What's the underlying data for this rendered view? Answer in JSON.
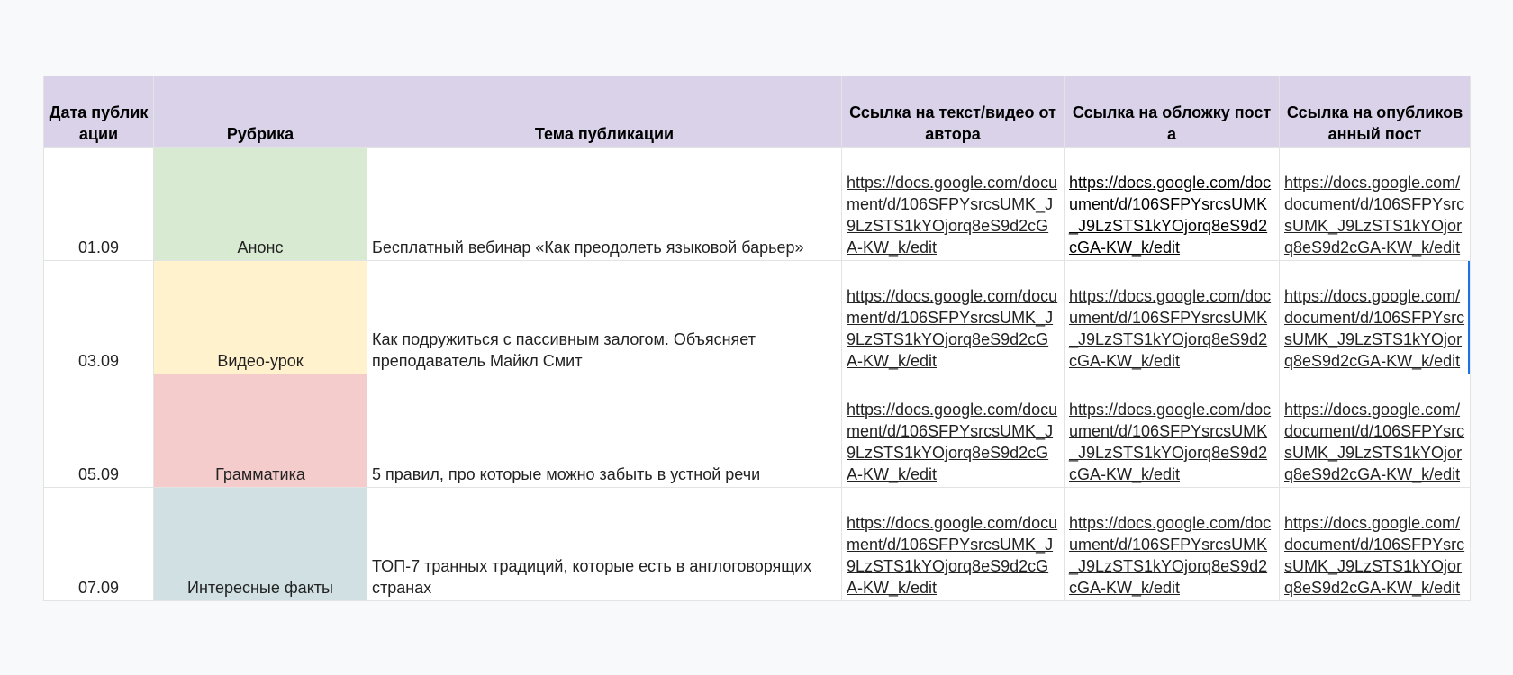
{
  "headers": {
    "date": "Дата публикации",
    "rubric": "Рубрика",
    "topic": "Тема публикации",
    "author_link": "Ссылка на текст/видео от автора",
    "cover_link": "Ссылка на обложку поста",
    "post_link": "Ссылка на опубликованный пост"
  },
  "colors": {
    "header_bg": "#d9d2e9",
    "link": "#1155cc",
    "rubric_announce": "#d9ead3",
    "rubric_video": "#fff2cc",
    "rubric_grammar": "#f4cccc",
    "rubric_facts": "#d0e0e3"
  },
  "rows": [
    {
      "date": "01.09",
      "rubric": "Анонс",
      "topic": "Бесплатный вебинар «Как преодолеть языковой барьер»",
      "author_link": "https://docs.google.com/document/d/106SFPYsrcsUMK_J9LzSTS1kYOjorq8eS9d2cGA-KW_k/edit",
      "cover_link": "https://docs.google.com/document/d/106SFPYsrcsUMK_J9LzSTS1kYOjorq8eS9d2cGA-KW_k/edit",
      "post_link": "https://docs.google.com/document/d/106SFPYsrcsUMK_J9LzSTS1kYOjorq8eS9d2cGA-KW_k/edit"
    },
    {
      "date": "03.09",
      "rubric": "Видео-урок",
      "topic": "Как подружиться с пассивным залогом. Объясняет преподаватель Майкл Смит",
      "author_link": "https://docs.google.com/document/d/106SFPYsrcsUMK_J9LzSTS1kYOjorq8eS9d2cGA-KW_k/edit",
      "cover_link": "https://docs.google.com/document/d/106SFPYsrcsUMK_J9LzSTS1kYOjorq8eS9d2cGA-KW_k/edit",
      "post_link": "https://docs.google.com/document/d/106SFPYsrcsUMK_J9LzSTS1kYOjorq8eS9d2cGA-KW_k/edit"
    },
    {
      "date": "05.09",
      "rubric": "Грамматика",
      "topic": "5 правил, про которые можно забыть в устной речи",
      "author_link": "https://docs.google.com/document/d/106SFPYsrcsUMK_J9LzSTS1kYOjorq8eS9d2cGA-KW_k/edit",
      "cover_link": "https://docs.google.com/document/d/106SFPYsrcsUMK_J9LzSTS1kYOjorq8eS9d2cGA-KW_k/edit",
      "post_link": "https://docs.google.com/document/d/106SFPYsrcsUMK_J9LzSTS1kYOjorq8eS9d2cGA-KW_k/edit"
    },
    {
      "date": "07.09",
      "rubric": "Интересные факты",
      "topic": "ТОП-7 транных традиций, которые есть в англоговорящих странах",
      "author_link": "https://docs.google.com/document/d/106SFPYsrcsUMK_J9LzSTS1kYOjorq8eS9d2cGA-KW_k/edit",
      "cover_link": "https://docs.google.com/document/d/106SFPYsrcsUMK_J9LzSTS1kYOjorq8eS9d2cGA-KW_k/edit",
      "post_link": "https://docs.google.com/document/d/106SFPYsrcsUMK_J9LzSTS1kYOjorq8eS9d2cGA-KW_k/edit"
    }
  ]
}
